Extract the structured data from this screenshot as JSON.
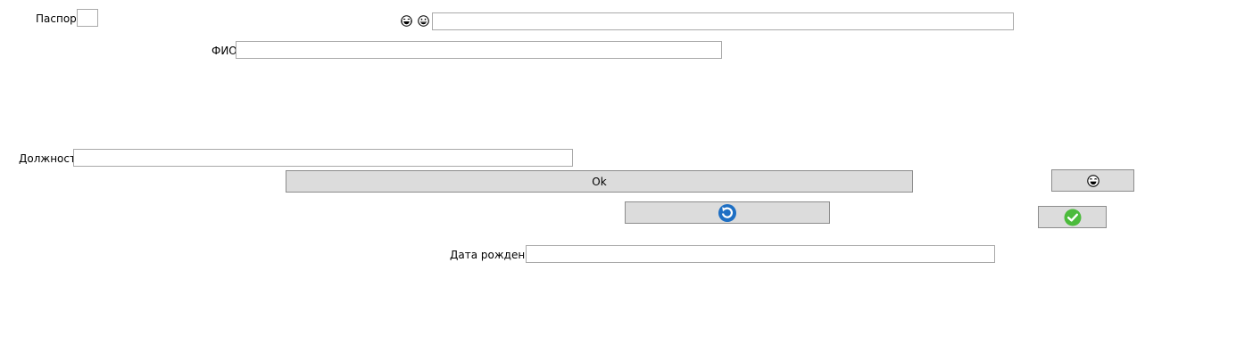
{
  "form": {
    "passport_label": "Паспорт",
    "passport_value": "",
    "fio_label": "ФИО",
    "fio_value": "",
    "position_label": "Должность",
    "position_value": "",
    "birthdate_label": "Дата рождения",
    "birthdate_value": "",
    "top_field_value": ""
  },
  "buttons": {
    "ok_label": "Ok"
  },
  "icons": {
    "face_laughing": "face-with-tears-of-joy-icon",
    "face_grin": "grinning-face-icon",
    "refresh": "refresh-icon",
    "check": "checkmark-icon"
  },
  "colors": {
    "button_bg": "#dcdcdc",
    "refresh_blue": "#1e6fc4",
    "check_green": "#4cbb3c"
  }
}
